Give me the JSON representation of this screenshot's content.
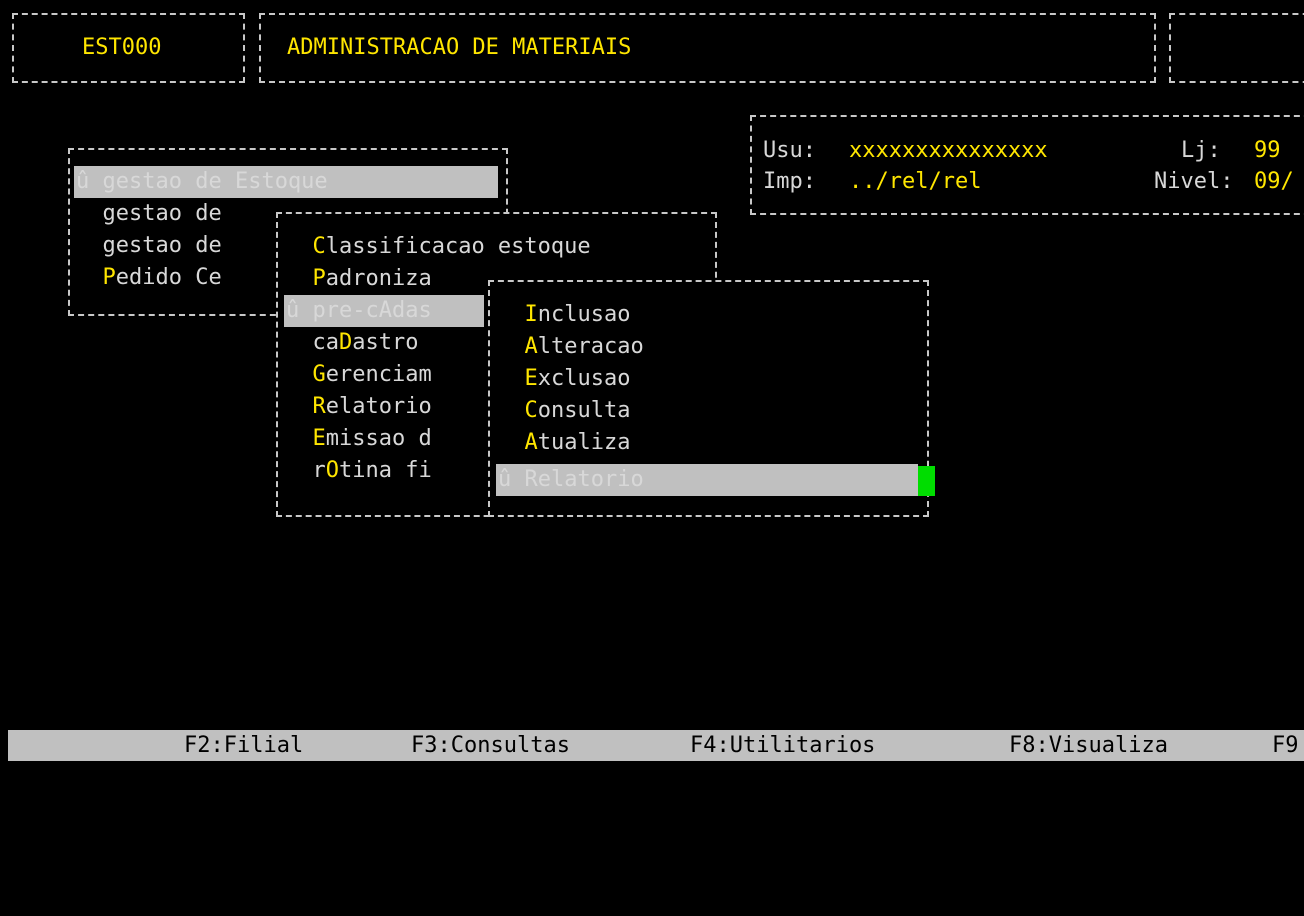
{
  "header": {
    "program_code": "EST000",
    "system_title": "ADMINISTRACAO DE MATERIAIS",
    "right_box_text": ""
  },
  "user_info": {
    "user_label": "Usu:",
    "user_value": "xxxxxxxxxxxxxxx",
    "store_label": "Lj:",
    "store_value": "99",
    "printer_label": "Imp:",
    "printer_value": "../rel/rel",
    "level_label": "Nivel:",
    "level_value": "09/"
  },
  "main_menu": {
    "items": [
      {
        "marker": "û ",
        "pre": "gestao de ",
        "hot": "E",
        "post": "stoque",
        "selected": true
      },
      {
        "marker": "  ",
        "pre": "gestao de",
        "hot": "",
        "post": "",
        "selected": false
      },
      {
        "marker": "  ",
        "pre": "gestao de",
        "hot": "",
        "post": "",
        "selected": false
      },
      {
        "marker": "  ",
        "pre": "",
        "hot": "P",
        "post": "edido Ce",
        "selected": false
      }
    ]
  },
  "stock_menu": {
    "items": [
      {
        "marker": "  ",
        "pre": "",
        "hot": "C",
        "post": "lassificacao estoque",
        "selected": false
      },
      {
        "marker": "  ",
        "pre": "",
        "hot": "P",
        "post": "adroniza",
        "selected": false
      },
      {
        "marker": "û ",
        "pre": "pre-c",
        "hot": "A",
        "post": "das",
        "selected": true
      },
      {
        "marker": "  ",
        "pre": "ca",
        "hot": "D",
        "post": "astro",
        "selected": false
      },
      {
        "marker": "  ",
        "pre": "",
        "hot": "G",
        "post": "erenciam",
        "selected": false
      },
      {
        "marker": "  ",
        "pre": "",
        "hot": "R",
        "post": "elatorio",
        "selected": false
      },
      {
        "marker": "  ",
        "pre": "",
        "hot": "E",
        "post": "missao d",
        "selected": false
      },
      {
        "marker": "  ",
        "pre": "r",
        "hot": "O",
        "post": "tina fi",
        "selected": false
      }
    ]
  },
  "precad_menu": {
    "items": [
      {
        "marker": "  ",
        "pre": "",
        "hot": "I",
        "post": "nclusao",
        "selected": false
      },
      {
        "marker": "  ",
        "pre": "",
        "hot": "A",
        "post": "lteracao",
        "selected": false
      },
      {
        "marker": "  ",
        "pre": "",
        "hot": "E",
        "post": "xclusao",
        "selected": false
      },
      {
        "marker": "  ",
        "pre": "",
        "hot": "C",
        "post": "onsulta",
        "selected": false
      },
      {
        "marker": "  ",
        "pre": "",
        "hot": "A",
        "post": "tualiza",
        "selected": false
      },
      {
        "marker": "û ",
        "pre": "",
        "hot": "R",
        "post": "elatorio",
        "selected": true
      }
    ]
  },
  "function_keys": [
    {
      "label": "F2:Filial"
    },
    {
      "label": "F3:Consultas"
    },
    {
      "label": "F4:Utilitarios"
    },
    {
      "label": "F8:Visualiza"
    },
    {
      "label": "F9"
    }
  ]
}
